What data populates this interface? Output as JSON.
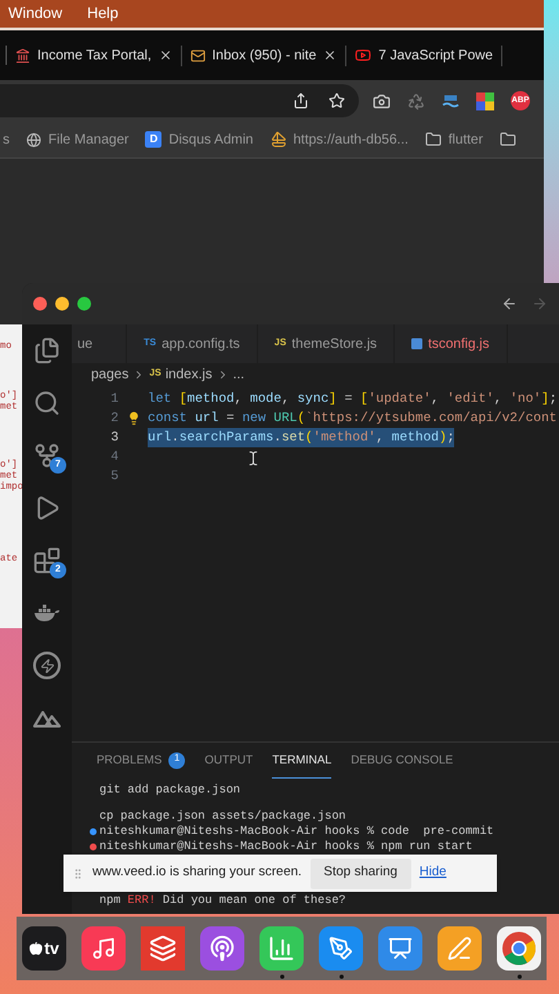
{
  "menu_bar": {
    "items": [
      "Window",
      "Help"
    ]
  },
  "browser": {
    "tabs": [
      {
        "title": "Income Tax Portal,",
        "kind": "tax"
      },
      {
        "title": "Inbox (950) - nite",
        "kind": "mail"
      },
      {
        "title": "7 JavaScript Powe",
        "kind": "video"
      }
    ],
    "extensions": [
      {
        "kind": "camera"
      },
      {
        "kind": "recycle"
      },
      {
        "kind": "lt"
      },
      {
        "kind": "colors"
      },
      {
        "kind": "abp",
        "label": "ABP"
      }
    ],
    "bookmarks": [
      {
        "title": "s"
      },
      {
        "title": "File Manager",
        "kind": "globe"
      },
      {
        "title": "Disqus Admin",
        "kind": "letter",
        "letter": "D"
      },
      {
        "title": "https://auth-db56...",
        "kind": "sail"
      },
      {
        "title": "flutter",
        "kind": "folder"
      },
      {
        "kind": "folder"
      }
    ]
  },
  "left_window_fragments": [
    "mo",
    "o']",
    "met",
    "o']",
    "met",
    "impo",
    "ate"
  ],
  "vscode": {
    "tabs": [
      {
        "label": "ue",
        "error": false
      },
      {
        "label": "app.config.ts",
        "badge": "TS",
        "error": false
      },
      {
        "label": "themeStore.js",
        "badge": "JS",
        "error": false
      },
      {
        "label": "tsconfig.js",
        "error": true
      }
    ],
    "breadcrumb": [
      {
        "text": "pages"
      },
      {
        "text": "index.js",
        "badge": "JS"
      },
      {
        "text": "..."
      }
    ],
    "activity_bar": [
      {
        "kind": "files"
      },
      {
        "kind": "search"
      },
      {
        "kind": "source-control",
        "badge": "7"
      },
      {
        "kind": "run"
      },
      {
        "kind": "extensions",
        "badge": "2"
      },
      {
        "kind": "docker"
      },
      {
        "kind": "bolt"
      },
      {
        "kind": "mountains"
      }
    ],
    "code_lines": [
      {
        "number": "1",
        "selected": false,
        "tokens": [
          {
            "t": "let ",
            "kind": "kw"
          },
          {
            "t": "[",
            "kind": "br"
          },
          {
            "t": "method",
            "kind": "var"
          },
          {
            "t": ", ",
            "kind": "p"
          },
          {
            "t": "mode",
            "kind": "var"
          },
          {
            "t": ", ",
            "kind": "p"
          },
          {
            "t": "sync",
            "kind": "var"
          },
          {
            "t": "]",
            "kind": "br"
          },
          {
            "t": " = ",
            "kind": "p"
          },
          {
            "t": "[",
            "kind": "br"
          },
          {
            "t": "'update'",
            "kind": "str"
          },
          {
            "t": ", ",
            "kind": "p"
          },
          {
            "t": "'edit'",
            "kind": "str"
          },
          {
            "t": ", ",
            "kind": "p"
          },
          {
            "t": "'no'",
            "kind": "str"
          },
          {
            "t": "]",
            "kind": "br"
          },
          {
            "t": ";",
            "kind": "p"
          }
        ]
      },
      {
        "number": "2",
        "selected": false,
        "tokens": [
          {
            "t": "const ",
            "kind": "kw"
          },
          {
            "t": "url",
            "kind": "var"
          },
          {
            "t": " = ",
            "kind": "p"
          },
          {
            "t": "new ",
            "kind": "kw"
          },
          {
            "t": "URL",
            "kind": "cls"
          },
          {
            "t": "(",
            "kind": "br"
          },
          {
            "t": "`https://ytsubme.com/api/v2/cont",
            "kind": "str"
          }
        ]
      },
      {
        "number": "3",
        "selected": true,
        "tokens": [
          {
            "t": "url",
            "kind": "var"
          },
          {
            "t": ".",
            "kind": "p"
          },
          {
            "t": "searchParams",
            "kind": "var"
          },
          {
            "t": ".",
            "kind": "p"
          },
          {
            "t": "set",
            "kind": "fn"
          },
          {
            "t": "(",
            "kind": "br"
          },
          {
            "t": "'method'",
            "kind": "str"
          },
          {
            "t": ", ",
            "kind": "p"
          },
          {
            "t": "method",
            "kind": "var"
          },
          {
            "t": ")",
            "kind": "br"
          },
          {
            "t": ";",
            "kind": "p"
          }
        ]
      },
      {
        "number": "4",
        "selected": false
      },
      {
        "number": "5",
        "selected": false
      }
    ],
    "panel_tabs": [
      {
        "label": "PROBLEMS",
        "badge": "1",
        "selected": false
      },
      {
        "label": "OUTPUT",
        "selected": false
      },
      {
        "label": "TERMINAL",
        "selected": true
      },
      {
        "label": "DEBUG CONSOLE",
        "selected": false
      }
    ],
    "terminal": [
      {
        "kind": "text",
        "parts": [
          {
            "t": "git add package.json"
          }
        ]
      },
      {
        "kind": "blank"
      },
      {
        "kind": "text",
        "parts": [
          {
            "t": "cp package.json assets/package.json"
          }
        ]
      },
      {
        "kind": "prompt",
        "color": "#3794ff",
        "parts": [
          {
            "t": "niteshkumar@Niteshs-MacBook-Air hooks % code  pre-commit"
          }
        ]
      },
      {
        "kind": "prompt",
        "color": "#f14c4c",
        "parts": [
          {
            "t": "niteshkumar@Niteshs-MacBook-Air hooks % npm run start"
          }
        ]
      },
      {
        "kind": "banner_gap"
      },
      {
        "kind": "text",
        "parts": [
          {
            "t": "npm "
          },
          {
            "t": "ERR!",
            "kind": "error"
          },
          {
            "t": " Did you mean one of these?"
          }
        ]
      }
    ]
  },
  "share_banner": {
    "message": "www.veed.io is sharing your screen.",
    "stop_button": "Stop sharing",
    "hide_link": "Hide"
  },
  "dock": [
    {
      "kind": "tv",
      "label": "tv",
      "running": false
    },
    {
      "kind": "music",
      "running": false
    },
    {
      "kind": "todoist",
      "running": false
    },
    {
      "kind": "podcasts",
      "running": false
    },
    {
      "kind": "numbers",
      "running": true
    },
    {
      "kind": "appstore",
      "running": true
    },
    {
      "kind": "keynote",
      "running": false
    },
    {
      "kind": "pages",
      "running": false
    },
    {
      "kind": "chrome",
      "running": true
    }
  ]
}
